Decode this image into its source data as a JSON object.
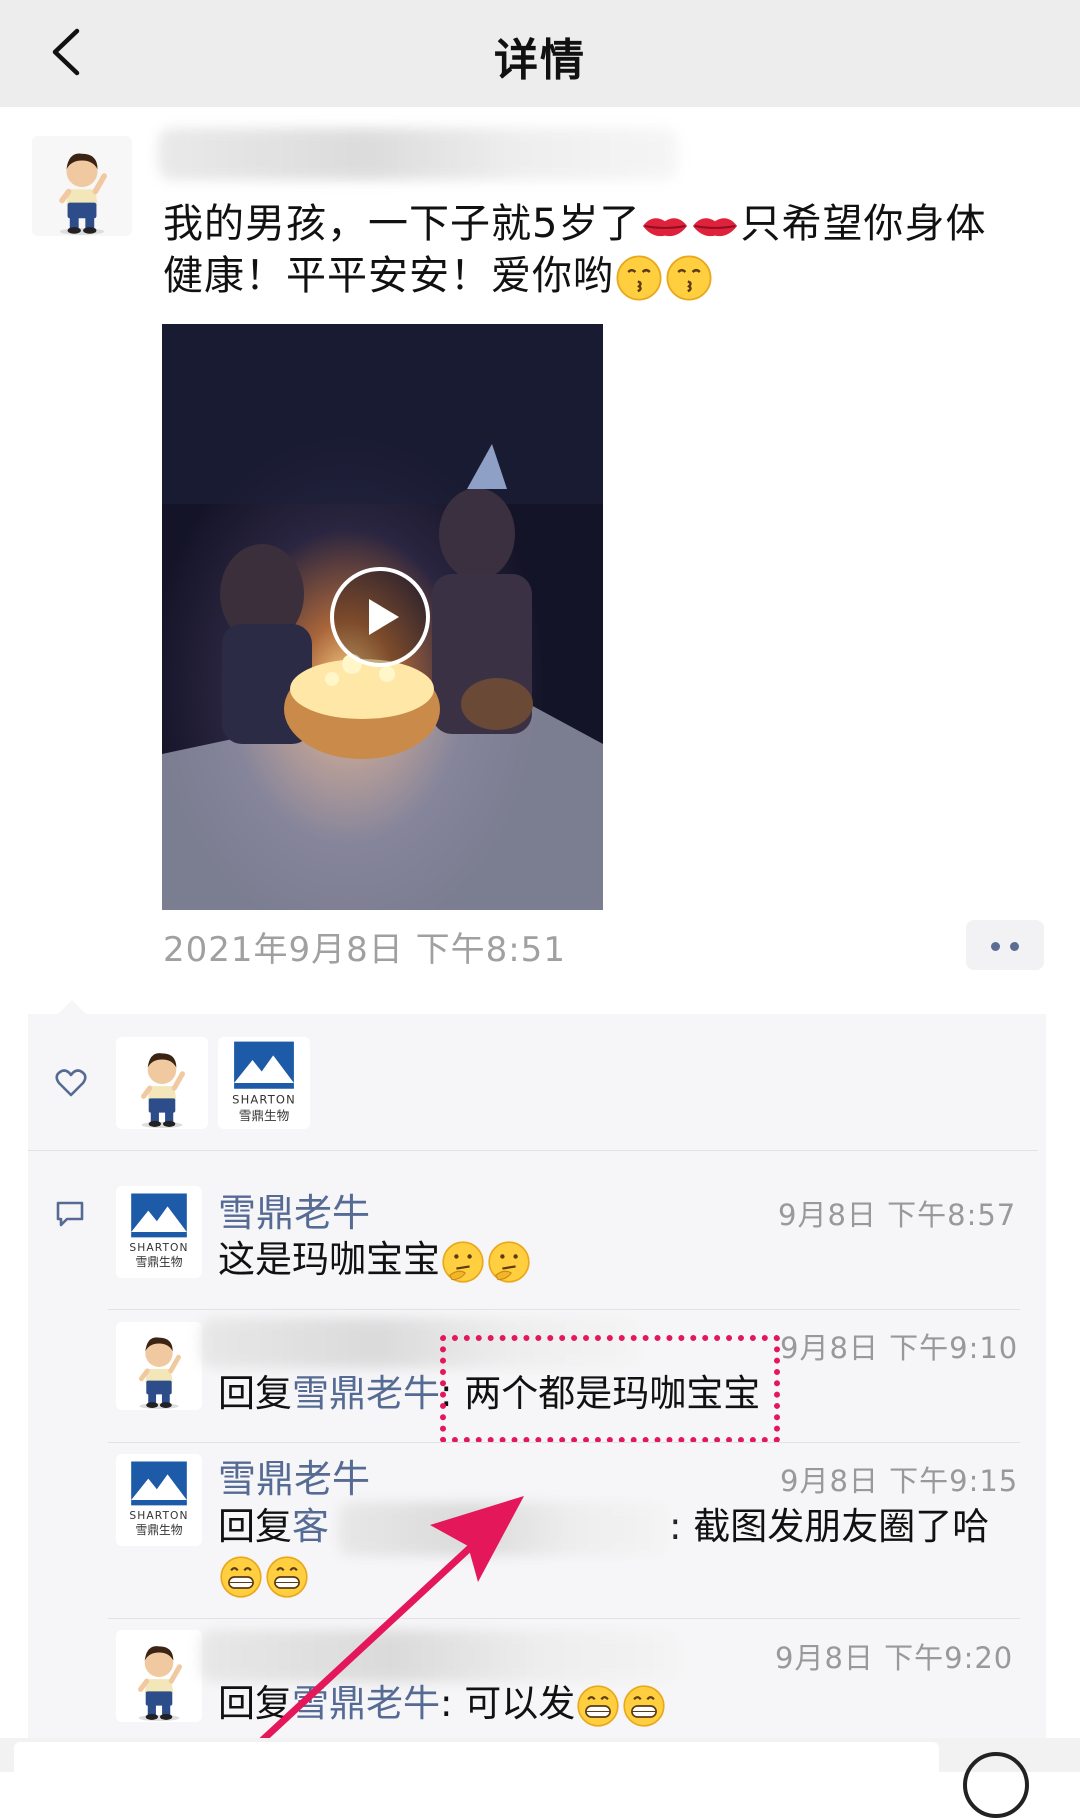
{
  "header": {
    "title": "详情"
  },
  "post": {
    "text_line1": "我的男孩，一下子就5岁了",
    "text_line1_tail": "只希望你身体",
    "text_line2": "健康！平平安安！爱你哟",
    "timestamp": "2021年9月8日 下午8:51"
  },
  "likes": {
    "logo_brand_en": "SHARTON",
    "logo_brand_cn": "雪鼎生物"
  },
  "comments": [
    {
      "name": "雪鼎老牛",
      "time": "9月8日 下午8:57",
      "text": "这是玛咖宝宝"
    },
    {
      "time": "9月8日 下午9:10",
      "reply_prefix": "回复",
      "reply_to": "雪鼎老牛",
      "text": ": 两个都是玛咖宝宝"
    },
    {
      "name": "雪鼎老牛",
      "time": "9月8日 下午9:15",
      "reply_prefix": "回复",
      "reply_to": "客",
      "text": ": 截图发朋友圈了哈"
    },
    {
      "time": "9月8日 下午9:20",
      "reply_prefix": "回复",
      "reply_to": "雪鼎老牛",
      "text": ": 可以发"
    }
  ],
  "colors": {
    "accent_link": "#566b94",
    "annotation": "#e3175a"
  }
}
